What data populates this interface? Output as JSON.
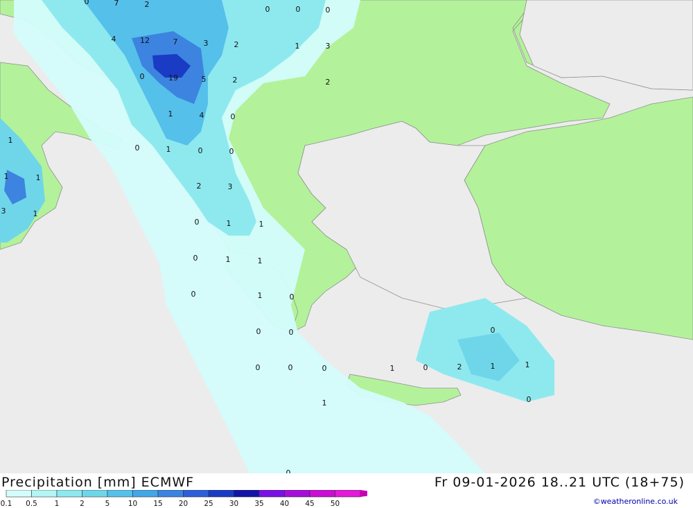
{
  "title": "Precipitation [mm] ECMWF",
  "datetime": "Fr 09-01-2026 18..21 UTC (18+75)",
  "credit": "©weatheronline.co.uk",
  "colors": {
    "sea": "#ececec",
    "land": "#b3f29a",
    "coast": "#8e8e8e"
  },
  "legend": {
    "ticks": [
      "0.1",
      "0.5",
      "1",
      "2",
      "5",
      "10",
      "15",
      "20",
      "25",
      "30",
      "35",
      "40",
      "45",
      "50"
    ],
    "colors": [
      "#d4fcfc",
      "#b4f5f5",
      "#8ee9ef",
      "#6fd6ea",
      "#55c0ea",
      "#42a6e8",
      "#3c84e0",
      "#2d5fd8",
      "#1a3bc4",
      "#1414a8",
      "#7a10e8",
      "#a50ed8",
      "#ca0ed4",
      "#e31ad8",
      "#c800b4"
    ]
  },
  "values": [
    "0",
    "7",
    "2",
    "0",
    "0",
    "0",
    "4",
    "12",
    "7",
    "3",
    "2",
    "1",
    "3",
    "0",
    "19",
    "5",
    "2",
    "2",
    "1",
    "4",
    "0",
    "1",
    "0",
    "1",
    "0",
    "0",
    "1",
    "1",
    "2",
    "3",
    "3",
    "1",
    "0",
    "1",
    "1",
    "0",
    "1",
    "1",
    "0",
    "1",
    "0",
    "0",
    "0",
    "0",
    "0",
    "0",
    "1",
    "0",
    "2",
    "1",
    "1",
    "0",
    "0",
    "1",
    "0"
  ]
}
